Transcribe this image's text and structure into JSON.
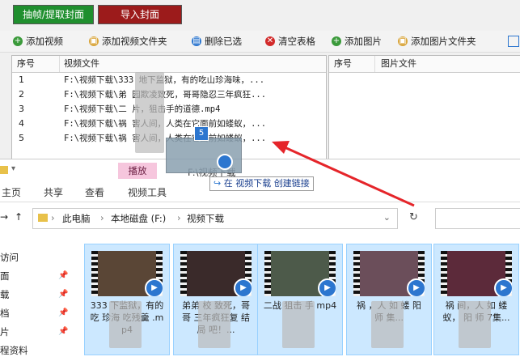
{
  "top_buttons": {
    "extract": "抽帧/提取封面",
    "import_cover": "导入封面"
  },
  "toolbar": [
    {
      "label": "添加视频",
      "icon": "add-icon",
      "color": "#3a9a3a"
    },
    {
      "label": "添加视频文件夹",
      "icon": "folder-add-icon",
      "color": "#d9a53a"
    },
    {
      "label": "删除已选",
      "icon": "delete-selected-icon",
      "color": "#2c76cf"
    },
    {
      "label": "清空表格",
      "icon": "clear-icon",
      "color": "#d22a2a"
    },
    {
      "label": "添加图片",
      "icon": "add-icon",
      "color": "#3a9a3a"
    },
    {
      "label": "添加图片文件夹",
      "icon": "folder-add-icon",
      "color": "#d9a53a"
    }
  ],
  "video_grid": {
    "headers": [
      "序号",
      "视频文件"
    ],
    "rows": [
      [
        "1",
        "F:\\视频下载\\333 地下监狱，有的吃山珍海味，..."
      ],
      [
        "2",
        "F:\\视频下载\\弟 园欺凌致死，哥哥隐忍三年疯狂..."
      ],
      [
        "3",
        "F:\\视频下载\\二 片，狙击手的道德.mp4"
      ],
      [
        "4",
        "F:\\视频下载\\祸 害人间，人类在它面前如蝼蚁，..."
      ],
      [
        "5",
        "F:\\视频下载\\祸 害人间，人类在它面前如蝼蚁，..."
      ]
    ]
  },
  "image_grid": {
    "headers": [
      "序号",
      "图片文件"
    ]
  },
  "drag": {
    "count": "5",
    "tooltip_prefix": "在 视频下载 ",
    "tooltip_action": "创建链接"
  },
  "explorer": {
    "context_tab": "播放",
    "window_title": "F:\\视频下载",
    "ribbon_tabs": [
      "主页",
      "共享",
      "查看",
      "视频工具"
    ],
    "breadcrumbs": [
      "此电脑",
      "本地磁盘 (F:)",
      "视频下载"
    ],
    "nav_items": [
      "访问",
      "面",
      "载",
      "档",
      "片",
      "程资料"
    ],
    "files": [
      {
        "label": "333 下监狱，有的吃 珍海 吃残羹 .mp4",
        "scene": "#5a4636"
      },
      {
        "label": "弟弟 校 致死，哥哥 三年疯狂复 结局 吧！...",
        "scene": "#3a2a2a"
      },
      {
        "label": "二战 狙击 手 mp4",
        "scene": "#4d5a4a"
      },
      {
        "label": "祸 ，人 如 蝼 阳 师 集...",
        "scene": "#6b4e5a"
      },
      {
        "label": "祸 间，人 如 蝼蚁， 阳 师 7集...",
        "scene": "#5c2a3a"
      }
    ]
  }
}
